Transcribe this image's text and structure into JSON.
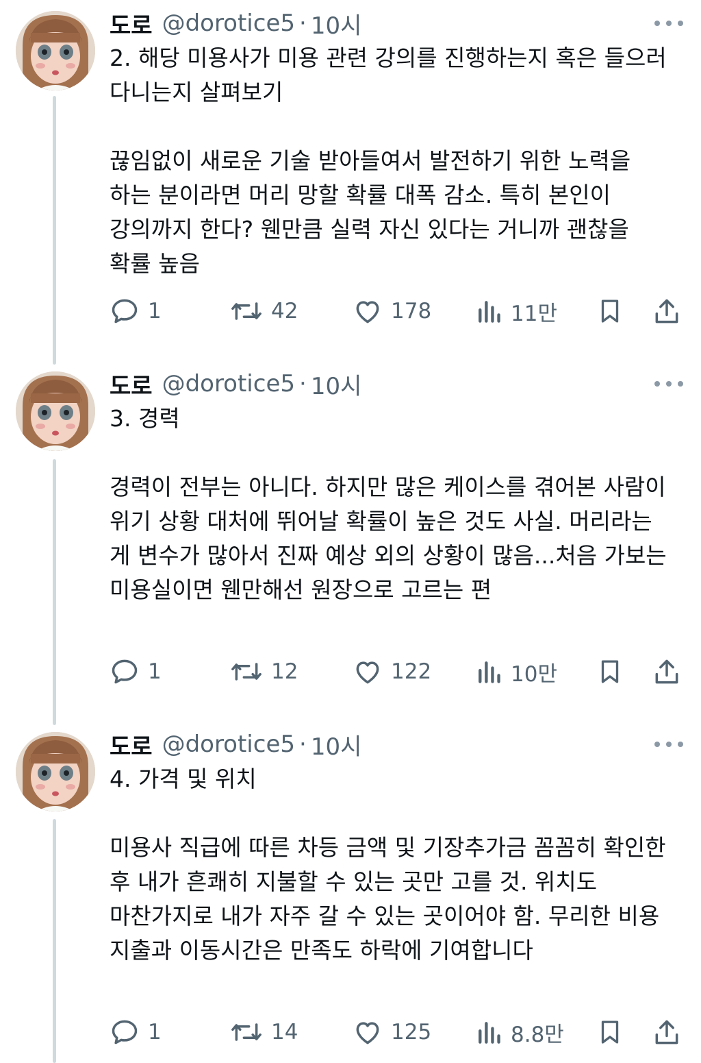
{
  "tweets": [
    {
      "name": "도로",
      "handle": "@dorotice5",
      "separator": "·",
      "time": "10시",
      "text": "2. 해당 미용사가 미용 관련 강의를 진행하는지 혹은 들으러 다니는지 살펴보기\n\n끊임없이 새로운 기술 받아들여서 발전하기 위한 노력을 하는 분이라면 머리 망할 확률 대폭 감소. 특히 본인이 강의까지 한다? 웬만큼 실력 자신 있다는 거니까 괜찮을 확률 높음",
      "replies": "1",
      "retweets": "42",
      "likes": "178",
      "views": "11만"
    },
    {
      "name": "도로",
      "handle": "@dorotice5",
      "separator": "·",
      "time": "10시",
      "text": "3. 경력\n\n경력이 전부는 아니다. 하지만 많은 케이스를 겪어본 사람이 위기 상황 대처에 뛰어날 확률이 높은 것도 사실. 머리라는 게 변수가 많아서 진짜 예상 외의 상황이 많음...처음 가보는 미용실이면 웬만해선 원장으로 고르는 편",
      "replies": "1",
      "retweets": "12",
      "likes": "122",
      "views": "10만"
    },
    {
      "name": "도로",
      "handle": "@dorotice5",
      "separator": "·",
      "time": "10시",
      "text": "4. 가격 및 위치\n\n미용사 직급에 따른 차등 금액 및 기장추가금 꼼꼼히 확인한 후 내가 흔쾌히 지불할 수 있는 곳만 고를 것. 위치도 마찬가지로 내가 자주 갈 수 있는 곳이어야 함. 무리한 비용 지출과 이동시간은 만족도 하락에 기여합니다",
      "replies": "1",
      "retweets": "14",
      "likes": "125",
      "views": "8.8만"
    }
  ],
  "icons": {
    "reply": "reply-bubble-icon",
    "retweet": "retweet-arrows-icon",
    "like": "heart-icon",
    "views": "analytics-bars-icon",
    "bookmark": "bookmark-icon",
    "share": "share-upload-icon",
    "more": "more-dots-icon"
  },
  "colors": {
    "text": "#0f1419",
    "secondary": "#536471",
    "thread_line": "#cfd9de"
  }
}
